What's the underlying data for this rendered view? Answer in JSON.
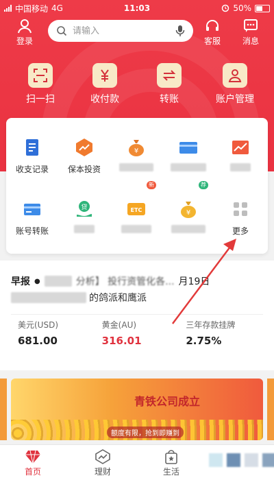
{
  "status": {
    "carrier": "中国移动",
    "network": "4G",
    "time": "11:03",
    "battery": "50%"
  },
  "header": {
    "login_label": "登录",
    "search_placeholder": "请输入",
    "service_label": "客服",
    "message_label": "消息"
  },
  "quick_actions": [
    {
      "label": "扫一扫",
      "icon": "scan-icon"
    },
    {
      "label": "收付款",
      "icon": "yen-icon"
    },
    {
      "label": "转账",
      "icon": "transfer-icon"
    },
    {
      "label": "账户管理",
      "icon": "account-icon"
    }
  ],
  "services": [
    {
      "label": "收支记录",
      "icon": "ledger-icon"
    },
    {
      "label": "保本投资",
      "icon": "trend-icon"
    },
    {
      "label": "",
      "icon": "money-bag-icon"
    },
    {
      "label": "",
      "icon": "card-icon"
    },
    {
      "label": "",
      "icon": "chart-icon"
    },
    {
      "label": "账号转账",
      "icon": "account-transfer-icon"
    },
    {
      "label": "",
      "icon": "loan-icon"
    },
    {
      "label": "",
      "icon": "etc-icon",
      "tag": "新"
    },
    {
      "label": "",
      "icon": "money-bag-icon",
      "tag": "荐"
    },
    {
      "label": "更多",
      "icon": "grid-icon"
    }
  ],
  "news": {
    "line1_prefix": "早报",
    "line1_text": "分析】 投行资管化各...",
    "line1_suffix": "月19日",
    "line2_text": "的鸽派和鹰派"
  },
  "rates": [
    {
      "label": "美元(USD)",
      "value": "681.00",
      "highlight": false
    },
    {
      "label": "黄金(AU)",
      "value": "316.01",
      "highlight": true
    },
    {
      "label": "三年存款挂牌",
      "value": "2.75%",
      "highlight": false
    }
  ],
  "banner": {
    "title": "青铁公司成立",
    "caption": "额度有限，抢到即赚到"
  },
  "nav": [
    {
      "label": "首页",
      "icon": "diamond-icon",
      "active": true
    },
    {
      "label": "理财",
      "icon": "wealth-icon",
      "active": false
    },
    {
      "label": "生活",
      "icon": "shopping-bag-icon",
      "active": false
    }
  ],
  "colors": {
    "brand_red": "#ea3241",
    "accent_gold": "#f8e9c7"
  }
}
